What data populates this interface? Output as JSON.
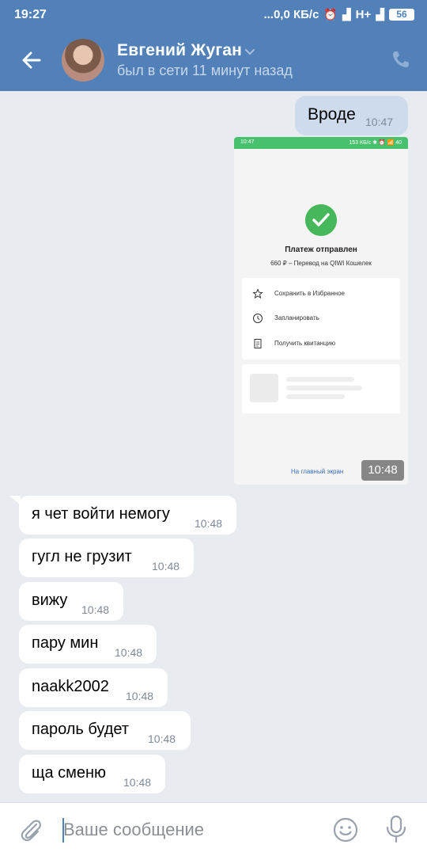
{
  "status_bar": {
    "time": "19:27",
    "speed": "...0,0 КБ/с",
    "network": "H+",
    "battery": "56"
  },
  "header": {
    "contact_name": "Евгений Жуган",
    "last_seen": "был в сети 11 минут назад"
  },
  "messages": {
    "outgoing_text": {
      "text": "Вроде",
      "time": "10:47"
    },
    "outgoing_photo": {
      "time": "10:48",
      "screenshot": {
        "status_time": "10:47",
        "status_right": "153 КБ/с ✱ ⏰ 📶 40",
        "title": "Платеж отправлен",
        "subtitle": "660 ₽ – Перевод на QIWI Кошелек",
        "actions": [
          "Сохранить в Избранное",
          "Запланировать",
          "Получить квитанцию"
        ],
        "action_icons": [
          "star-icon",
          "clock-icon",
          "receipt-icon"
        ],
        "link": "На главный экран"
      }
    },
    "incoming": [
      {
        "text": "я чет войти немогу",
        "time": "10:48"
      },
      {
        "text": "гугл не грузит",
        "time": "10:48"
      },
      {
        "text": "вижу",
        "time": "10:48"
      },
      {
        "text": "пару мин",
        "time": "10:48"
      },
      {
        "text": "naakk2002",
        "time": "10:48"
      },
      {
        "text": "пароль будет",
        "time": "10:48"
      },
      {
        "text": "ща сменю",
        "time": "10:48"
      }
    ]
  },
  "composer": {
    "placeholder": "Ваше сообщение"
  },
  "colors": {
    "header_bg": "#5181b8",
    "chat_bg": "#e8ebef",
    "outgoing_bubble": "#cddbec",
    "incoming_bubble": "#ffffff",
    "success_green": "#47b75b"
  }
}
